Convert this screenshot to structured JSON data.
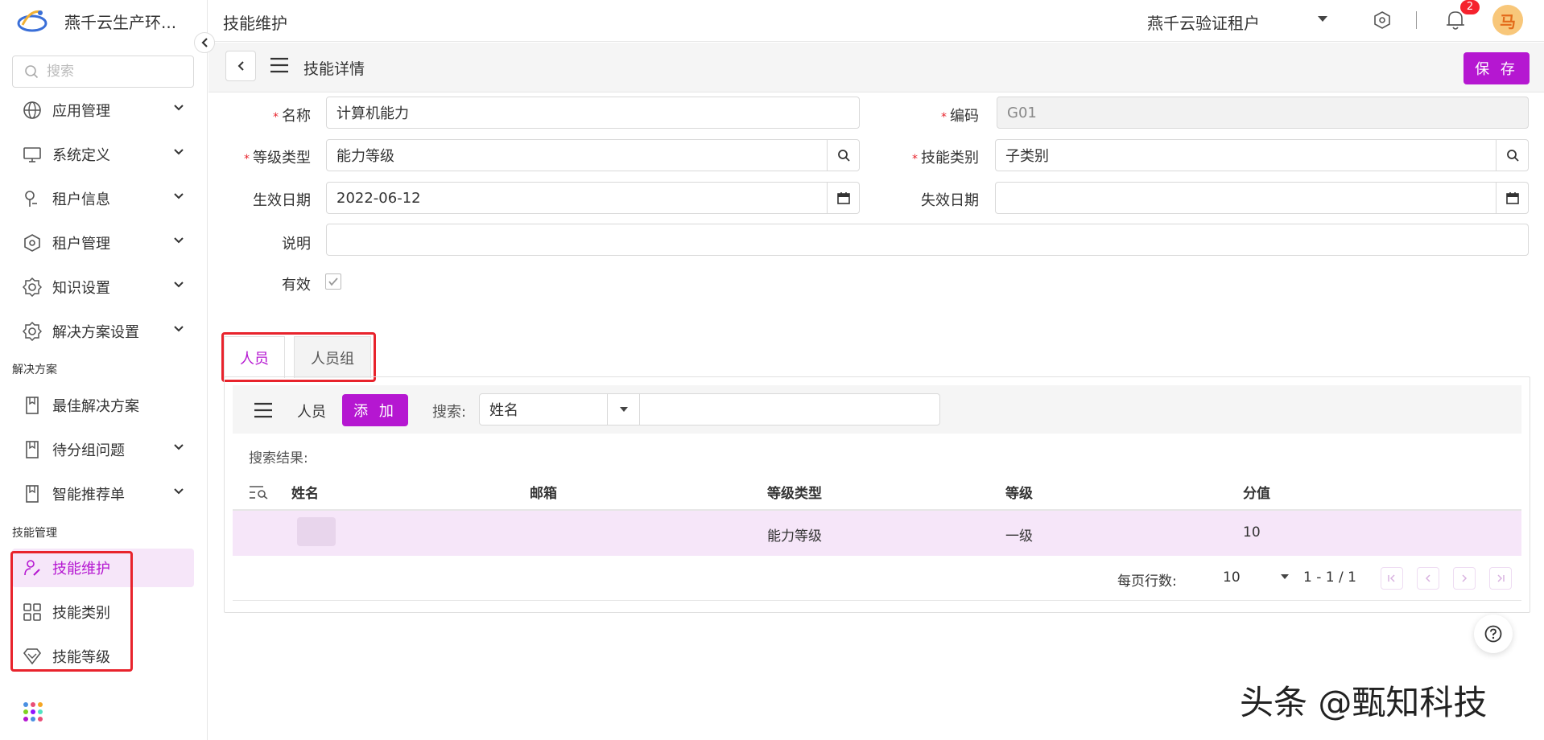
{
  "brand": {
    "title": "燕千云生产环..."
  },
  "sidebar": {
    "search_placeholder": "搜索",
    "items": [
      {
        "label": "应用管理"
      },
      {
        "label": "系统定义"
      },
      {
        "label": "租户信息"
      },
      {
        "label": "租户管理"
      },
      {
        "label": "知识设置"
      },
      {
        "label": "解决方案设置"
      }
    ],
    "section_solutions": "解决方案",
    "solutions_items": [
      {
        "label": "最佳解决方案"
      },
      {
        "label": "待分组问题"
      },
      {
        "label": "智能推荐单"
      }
    ],
    "section_skills": "技能管理",
    "skills_items": [
      {
        "label": "技能维护"
      },
      {
        "label": "技能类别"
      },
      {
        "label": "技能等级"
      }
    ]
  },
  "topbar": {
    "title": "技能维护",
    "tenant": "燕千云验证租户",
    "notification_count": "2",
    "avatar_text": "马"
  },
  "subheader": {
    "title": "技能详情",
    "save_label": "保 存"
  },
  "form": {
    "name_label": "名称",
    "name_value": "计算机能力",
    "code_label": "编码",
    "code_value": "G01",
    "level_type_label": "等级类型",
    "level_type_value": "能力等级",
    "skill_category_label": "技能类别",
    "skill_category_value": "子类别",
    "effective_date_label": "生效日期",
    "effective_date_value": "2022-06-12",
    "expiry_date_label": "失效日期",
    "expiry_date_value": "",
    "description_label": "说明",
    "description_value": "",
    "valid_label": "有效"
  },
  "tabs": [
    {
      "label": "人员"
    },
    {
      "label": "人员组"
    }
  ],
  "members": {
    "toolbar_label": "人员",
    "add_label": "添 加",
    "search_label": "搜索:",
    "search_field": "姓名",
    "result_label": "搜索结果:",
    "columns": [
      "姓名",
      "邮箱",
      "等级类型",
      "等级",
      "分值"
    ],
    "rows": [
      {
        "name": "",
        "email": "",
        "level_type": "能力等级",
        "level": "一级",
        "score": "10"
      }
    ],
    "rows_per_page_label": "每页行数:",
    "rows_per_page": "10",
    "range": "1 - 1 / 1"
  },
  "watermark": "头条 @甄知科技",
  "colors": {
    "accent": "#b517d1",
    "highlight": "#e8232c",
    "row_bg": "#f6e6f9"
  }
}
